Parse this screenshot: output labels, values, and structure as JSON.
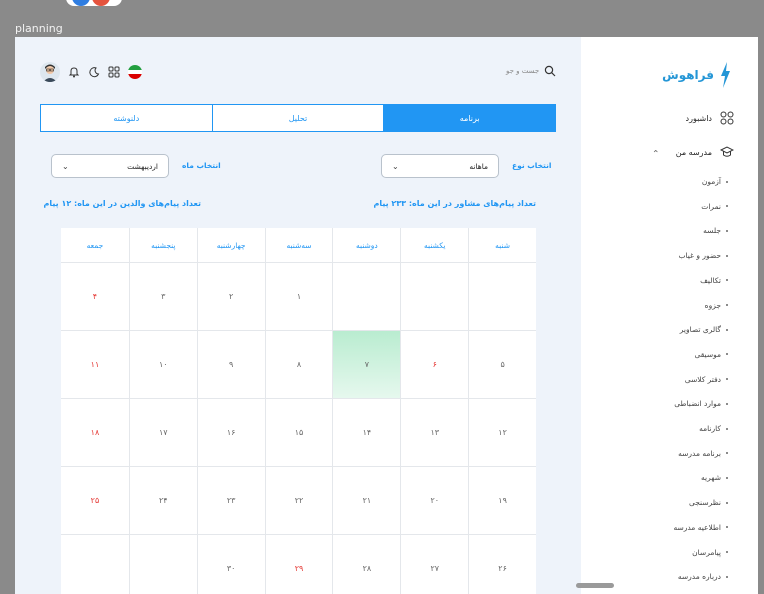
{
  "window": {
    "title": "planning"
  },
  "sidebar": {
    "brand": "فراهوش",
    "dashboard": "داشبورد",
    "school": "مدرسه من",
    "items": [
      "آزمون",
      "نمرات",
      "جلسه",
      "حضور و غیاب",
      "تکالیف",
      "جزوه",
      "گالری تصاویر",
      "موسیقی",
      "دفتر کلاسی",
      "موارد انضباطی",
      "کارنامه",
      "برنامه مدرسه",
      "شهریه",
      "نظرسنجی",
      "اطلاعیه مدرسه",
      "پیامرسان",
      "درباره مدرسه"
    ]
  },
  "header": {
    "search_placeholder": "جست و جو"
  },
  "tabs": [
    {
      "label": "برنامه",
      "active": true
    },
    {
      "label": "تحلیل",
      "active": false
    },
    {
      "label": "دلنوشته",
      "active": false
    }
  ],
  "filters": {
    "type_label": "انتخاب نوع",
    "type_value": "ماهانه",
    "month_label": "انتخاب ماه",
    "month_value": "اردیبهشت"
  },
  "stats": {
    "advisor_messages": "تعداد پیام‌های مشاور در این ماه: ۲۳۳ پیام",
    "parent_messages": "تعداد پیام‌های والدین در این ماه: ۱۲ پیام"
  },
  "calendar": {
    "weekdays": [
      "شنبه",
      "یکشنبه",
      "دوشنبه",
      "سه‌شنبه",
      "چهارشنبه",
      "پنجشنبه",
      "جمعه"
    ],
    "rows": [
      [
        "",
        "",
        "",
        "۱",
        "۲",
        "۳",
        "۴"
      ],
      [
        "۵",
        "۶",
        "۷",
        "۸",
        "۹",
        "۱۰",
        "۱۱"
      ],
      [
        "۱۲",
        "۱۳",
        "۱۴",
        "۱۵",
        "۱۶",
        "۱۷",
        "۱۸"
      ],
      [
        "۱۹",
        "۲۰",
        "۲۱",
        "۲۲",
        "۲۳",
        "۲۴",
        "۲۵"
      ],
      [
        "۲۶",
        "۲۷",
        "۲۸",
        "۲۹",
        "۳۰",
        "",
        ""
      ]
    ],
    "holidays": [
      [
        0,
        6
      ],
      [
        1,
        1
      ],
      [
        1,
        6
      ],
      [
        2,
        6
      ],
      [
        3,
        6
      ],
      [
        4,
        3
      ]
    ],
    "today": [
      1,
      2
    ]
  },
  "colors": {
    "accent": "#2196f3",
    "holiday": "#e53935",
    "today": "#c8f0da"
  }
}
